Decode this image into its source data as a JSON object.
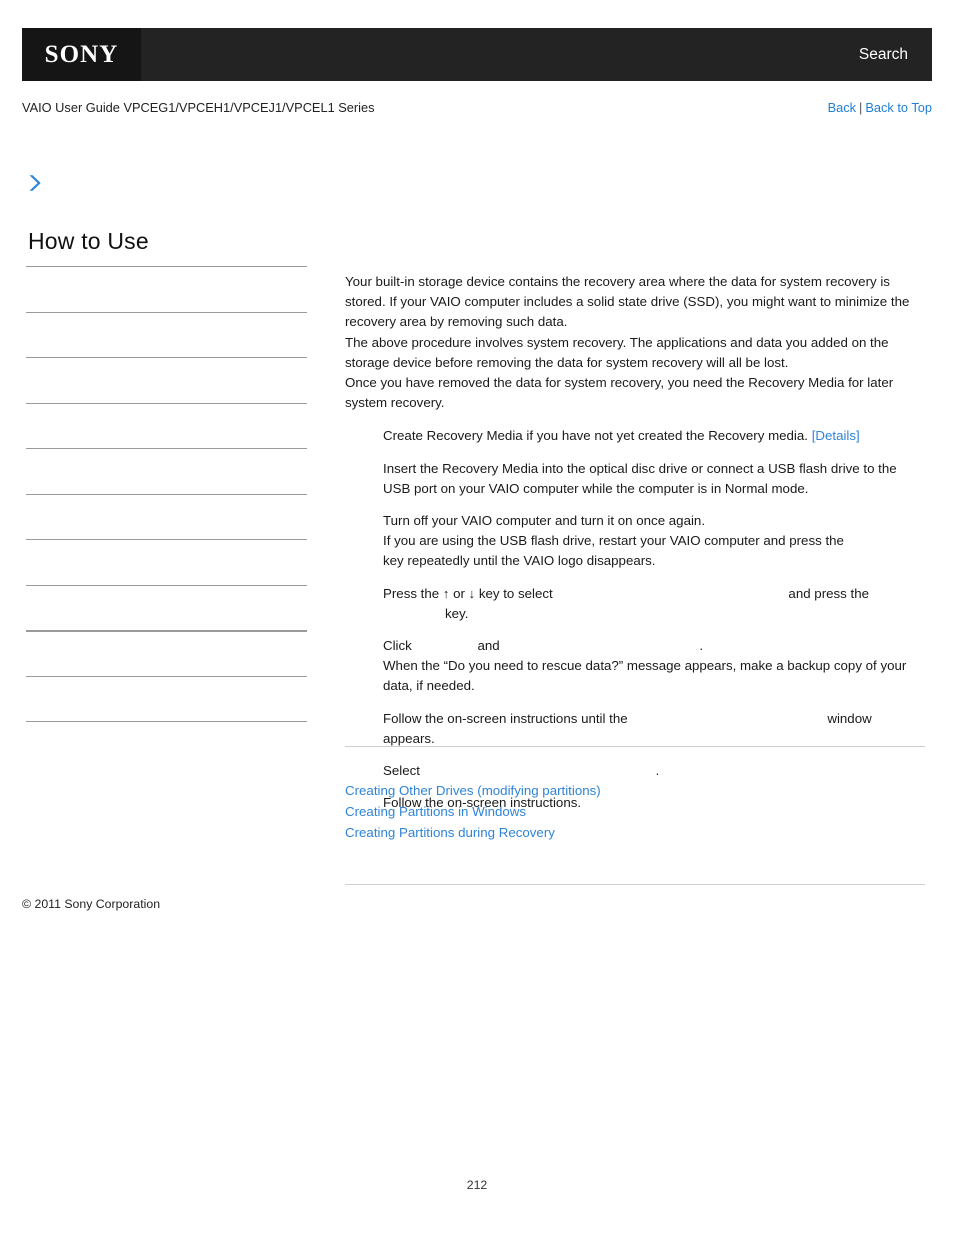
{
  "header": {
    "logo_text": "SONY",
    "search_label": "Search",
    "bar_color": "#232323",
    "logo_box_color": "#151515"
  },
  "subheader": {
    "guide_title": "VAIO User Guide VPCEG1/VPCEH1/VPCEJ1/VPCEL1 Series",
    "back_label": "Back",
    "separator": "|",
    "back_to_top_label": "Back to Top",
    "link_color": "#1f7fd4"
  },
  "sidebar": {
    "title": "How to Use",
    "items": [
      {
        "label": ""
      },
      {
        "label": ""
      },
      {
        "label": ""
      },
      {
        "label": ""
      },
      {
        "label": ""
      },
      {
        "label": ""
      },
      {
        "label": ""
      },
      {
        "label": ""
      },
      {
        "label": ""
      },
      {
        "label": ""
      },
      {
        "label": ""
      }
    ]
  },
  "content": {
    "intro": [
      "Your built-in storage device contains the recovery area where the data for system recovery is stored. If your VAIO computer includes a solid state drive (SSD), you might want to minimize the recovery area by removing such data.",
      "The above procedure involves system recovery. The applications and data you added on the storage device before removing the data for system recovery will all be lost.",
      "Once you have removed the data for system recovery, you need the Recovery Media for later system recovery."
    ],
    "steps": {
      "step1_text": "Create Recovery Media if you have not yet created the Recovery media.",
      "step1_link": "[Details]",
      "step2_text": "Insert the Recovery Media into the optical disc drive or connect a USB flash drive to the USB port on your VAIO computer while the computer is in Normal mode.",
      "step3_line1": "Turn off your VAIO computer and turn it on once again.",
      "step3_line2a": "If you are using the USB flash drive, restart your VAIO computer and press the",
      "step3_line2b": "key repeatedly until the VAIO logo disappears.",
      "step4_a": "Press the",
      "step4_arrow_up": "↑",
      "step4_or": "or",
      "step4_arrow_down": "↓",
      "step4_b": "key to select",
      "step4_c": "and press the",
      "step4_d": "key.",
      "step5_line1a": "Click",
      "step5_line1b": "and",
      "step5_line1c": ".",
      "step5_line2": "When the “Do you need to rescue data?” message appears, make a backup copy of your data, if needed.",
      "step6_a": "Follow the on-screen instructions until the",
      "step6_b": "window appears.",
      "step7_a": "Select",
      "step7_b": ".",
      "step8": "Follow the on-screen instructions."
    }
  },
  "related_links": [
    "Creating Other Drives (modifying partitions)",
    "Creating Partitions in Windows",
    "Creating Partitions during Recovery"
  ],
  "footer": {
    "copyright": "© 2011 Sony Corporation",
    "page_number": "212"
  }
}
